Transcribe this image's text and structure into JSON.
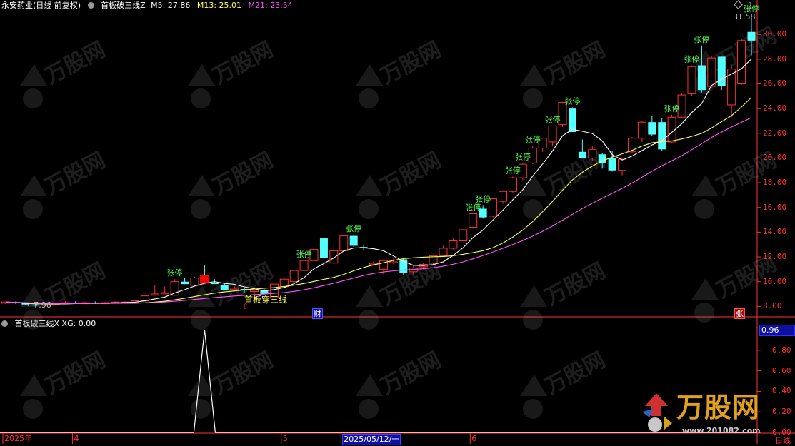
{
  "main_panel": {
    "stock_name": "永安药业(日线 前复权)",
    "indicator_name": "首板破三线Z",
    "m5": "M5: 27.86",
    "m13": "M13: 25.01",
    "m21": "M21: 23.54",
    "y_ticks": [
      "30.00",
      "28.00",
      "26.00",
      "24.00",
      "22.00",
      "20.00",
      "18.00",
      "16.00",
      "14.00",
      "12.00",
      "10.00",
      "8.00"
    ],
    "high_marker": "31.58",
    "low_marker": "←7.96",
    "signal_label": "首板穿三线",
    "limit_up_label": "张停",
    "badge_cai": "财",
    "badge_zhang": "张"
  },
  "sub_panel": {
    "indicator_label": "首板破三线X XG: 0.00",
    "current_value": "0.96",
    "y_ticks": [
      "0.80",
      "0.60",
      "0.40",
      "0.20",
      "0.00"
    ]
  },
  "x_axis": {
    "labels": [
      "2025年",
      "4",
      "5",
      "2025/05/12/一",
      "6"
    ],
    "period": "日线"
  },
  "watermark": {
    "brand": "万股网",
    "url": "www.201082.com"
  },
  "colors": {
    "up": "#ff3232",
    "down": "#54ffff",
    "m5": "#ffffff",
    "m13": "#ffff54",
    "m21": "#ff54ff",
    "limit_label": "#54ff54",
    "axis": "#ff3232"
  },
  "chart_data": {
    "type": "candlestick",
    "y_range": [
      7.5,
      31.8
    ],
    "candles": [
      {
        "o": 8.3,
        "h": 8.4,
        "l": 8.2,
        "c": 8.35
      },
      {
        "o": 8.35,
        "h": 8.4,
        "l": 8.2,
        "c": 8.25
      },
      {
        "o": 8.25,
        "h": 8.3,
        "l": 8.1,
        "c": 8.15
      },
      {
        "o": 8.15,
        "h": 8.3,
        "l": 7.96,
        "c": 8.1
      },
      {
        "o": 8.1,
        "h": 8.25,
        "l": 8.05,
        "c": 8.2
      },
      {
        "o": 8.2,
        "h": 8.3,
        "l": 8.1,
        "c": 8.25
      },
      {
        "o": 8.25,
        "h": 8.4,
        "l": 8.2,
        "c": 8.3
      },
      {
        "o": 8.3,
        "h": 8.4,
        "l": 8.2,
        "c": 8.25
      },
      {
        "o": 8.25,
        "h": 8.35,
        "l": 8.2,
        "c": 8.3
      },
      {
        "o": 8.3,
        "h": 8.4,
        "l": 8.2,
        "c": 8.25
      },
      {
        "o": 8.25,
        "h": 8.35,
        "l": 8.2,
        "c": 8.3
      },
      {
        "o": 8.3,
        "h": 8.4,
        "l": 8.25,
        "c": 8.35
      },
      {
        "o": 8.35,
        "h": 8.4,
        "l": 8.3,
        "c": 8.35
      },
      {
        "o": 8.35,
        "h": 8.5,
        "l": 8.3,
        "c": 8.45
      },
      {
        "o": 8.45,
        "h": 8.9,
        "l": 8.4,
        "c": 8.85
      },
      {
        "o": 8.9,
        "h": 9.7,
        "l": 8.9,
        "c": 9.0
      },
      {
        "o": 9.1,
        "h": 9.6,
        "l": 9.0,
        "c": 9.1
      },
      {
        "o": 8.9,
        "h": 10.2,
        "l": 8.9,
        "c": 10.0
      },
      {
        "o": 10.0,
        "h": 10.3,
        "l": 9.8,
        "c": 9.8
      },
      {
        "o": 9.7,
        "h": 10.4,
        "l": 9.6,
        "c": 10.3
      },
      {
        "o": 10.3,
        "h": 11.3,
        "l": 10.1,
        "c": 10.1
      },
      {
        "o": 9.9,
        "h": 10.2,
        "l": 9.8,
        "c": 9.8
      },
      {
        "o": 9.7,
        "h": 9.9,
        "l": 9.3,
        "c": 9.3
      },
      {
        "o": 9.4,
        "h": 9.6,
        "l": 9.2,
        "c": 9.4
      },
      {
        "o": 9.4,
        "h": 9.5,
        "l": 9.1,
        "c": 9.3
      },
      {
        "o": 9.2,
        "h": 9.5,
        "l": 8.9,
        "c": 9.3
      },
      {
        "o": 9.3,
        "h": 9.4,
        "l": 9.0,
        "c": 9.0
      },
      {
        "o": 8.7,
        "h": 9.8,
        "l": 8.7,
        "c": 9.8
      },
      {
        "o": 9.6,
        "h": 10.3,
        "l": 9.5,
        "c": 10.2
      },
      {
        "o": 10.0,
        "h": 10.9,
        "l": 10.0,
        "c": 10.9
      },
      {
        "o": 10.9,
        "h": 11.7,
        "l": 10.9,
        "c": 11.7
      },
      {
        "o": 11.7,
        "h": 12.6,
        "l": 11.6,
        "c": 12.6
      },
      {
        "o": 13.5,
        "h": 13.5,
        "l": 11.9,
        "c": 11.9
      },
      {
        "o": 11.5,
        "h": 13.0,
        "l": 11.4,
        "c": 12.5
      },
      {
        "o": 12.5,
        "h": 13.7,
        "l": 12.4,
        "c": 13.7
      },
      {
        "o": 13.7,
        "h": 13.8,
        "l": 12.8,
        "c": 12.9
      },
      {
        "o": 12.8,
        "h": 13.0,
        "l": 12.5,
        "c": 12.7
      },
      {
        "o": 11.5,
        "h": 11.6,
        "l": 11.4,
        "c": 11.5
      },
      {
        "o": 11.0,
        "h": 11.8,
        "l": 10.6,
        "c": 11.7
      },
      {
        "o": 11.6,
        "h": 11.9,
        "l": 11.4,
        "c": 11.6
      },
      {
        "o": 11.8,
        "h": 11.9,
        "l": 10.5,
        "c": 10.7
      },
      {
        "o": 10.8,
        "h": 11.3,
        "l": 10.6,
        "c": 11.1
      },
      {
        "o": 11.2,
        "h": 11.5,
        "l": 11.0,
        "c": 11.4
      },
      {
        "o": 11.5,
        "h": 12.1,
        "l": 11.4,
        "c": 12.1
      },
      {
        "o": 12.1,
        "h": 12.9,
        "l": 12.0,
        "c": 12.7
      },
      {
        "o": 12.7,
        "h": 13.5,
        "l": 12.6,
        "c": 13.3
      },
      {
        "o": 13.3,
        "h": 14.2,
        "l": 13.3,
        "c": 14.2
      },
      {
        "o": 14.4,
        "h": 15.5,
        "l": 14.3,
        "c": 15.5
      },
      {
        "o": 15.9,
        "h": 16.2,
        "l": 15.1,
        "c": 15.2
      },
      {
        "o": 15.3,
        "h": 16.8,
        "l": 15.2,
        "c": 16.7
      },
      {
        "o": 16.5,
        "h": 17.4,
        "l": 16.3,
        "c": 17.3
      },
      {
        "o": 17.3,
        "h": 18.5,
        "l": 17.2,
        "c": 18.4
      },
      {
        "o": 18.4,
        "h": 19.6,
        "l": 18.2,
        "c": 19.5
      },
      {
        "o": 19.6,
        "h": 21.0,
        "l": 19.5,
        "c": 20.8
      },
      {
        "o": 20.8,
        "h": 21.6,
        "l": 20.5,
        "c": 21.6
      },
      {
        "o": 21.3,
        "h": 22.6,
        "l": 21.0,
        "c": 22.6
      },
      {
        "o": 22.7,
        "h": 24.5,
        "l": 22.5,
        "c": 24.5
      },
      {
        "o": 24.0,
        "h": 24.1,
        "l": 22.1,
        "c": 22.1
      },
      {
        "o": 20.5,
        "h": 21.5,
        "l": 20.0,
        "c": 20.0
      },
      {
        "o": 20.0,
        "h": 21.0,
        "l": 19.8,
        "c": 20.7
      },
      {
        "o": 20.3,
        "h": 20.4,
        "l": 19.2,
        "c": 19.6
      },
      {
        "o": 20.0,
        "h": 20.6,
        "l": 18.9,
        "c": 19.0
      },
      {
        "o": 19.0,
        "h": 20.0,
        "l": 18.6,
        "c": 19.9
      },
      {
        "o": 20.5,
        "h": 21.7,
        "l": 20.4,
        "c": 21.6
      },
      {
        "o": 21.6,
        "h": 23.0,
        "l": 21.3,
        "c": 22.9
      },
      {
        "o": 22.9,
        "h": 23.4,
        "l": 21.8,
        "c": 21.9
      },
      {
        "o": 22.9,
        "h": 23.2,
        "l": 20.6,
        "c": 20.7
      },
      {
        "o": 21.3,
        "h": 23.5,
        "l": 21.2,
        "c": 23.3
      },
      {
        "o": 23.3,
        "h": 25.2,
        "l": 23.2,
        "c": 25.1
      },
      {
        "o": 25.2,
        "h": 27.5,
        "l": 25.0,
        "c": 27.4
      },
      {
        "o": 27.5,
        "h": 29.1,
        "l": 25.3,
        "c": 25.5
      },
      {
        "o": 25.8,
        "h": 28.2,
        "l": 25.7,
        "c": 28.1
      },
      {
        "o": 28.2,
        "h": 28.2,
        "l": 25.5,
        "c": 25.8
      },
      {
        "o": 24.3,
        "h": 27.5,
        "l": 23.3,
        "c": 27.2
      },
      {
        "o": 26.0,
        "h": 29.6,
        "l": 25.9,
        "c": 29.5
      },
      {
        "o": 30.2,
        "h": 31.58,
        "l": 28.3,
        "c": 29.5
      }
    ],
    "x_tick_indices": {
      "2025年": 0,
      "4": 7,
      "5": 28,
      "2025/05/12/一": 34,
      "6": 47
    },
    "limit_up_indices": [
      17,
      30,
      35,
      47,
      48,
      51,
      52,
      53,
      55,
      57,
      67,
      69,
      70,
      75
    ],
    "signal_index": 20,
    "xg_spike_index": 20,
    "series": [
      {
        "name": "M5",
        "color": "#ffffff"
      },
      {
        "name": "M13",
        "color": "#ffff54"
      },
      {
        "name": "M21",
        "color": "#ff54ff"
      }
    ]
  }
}
